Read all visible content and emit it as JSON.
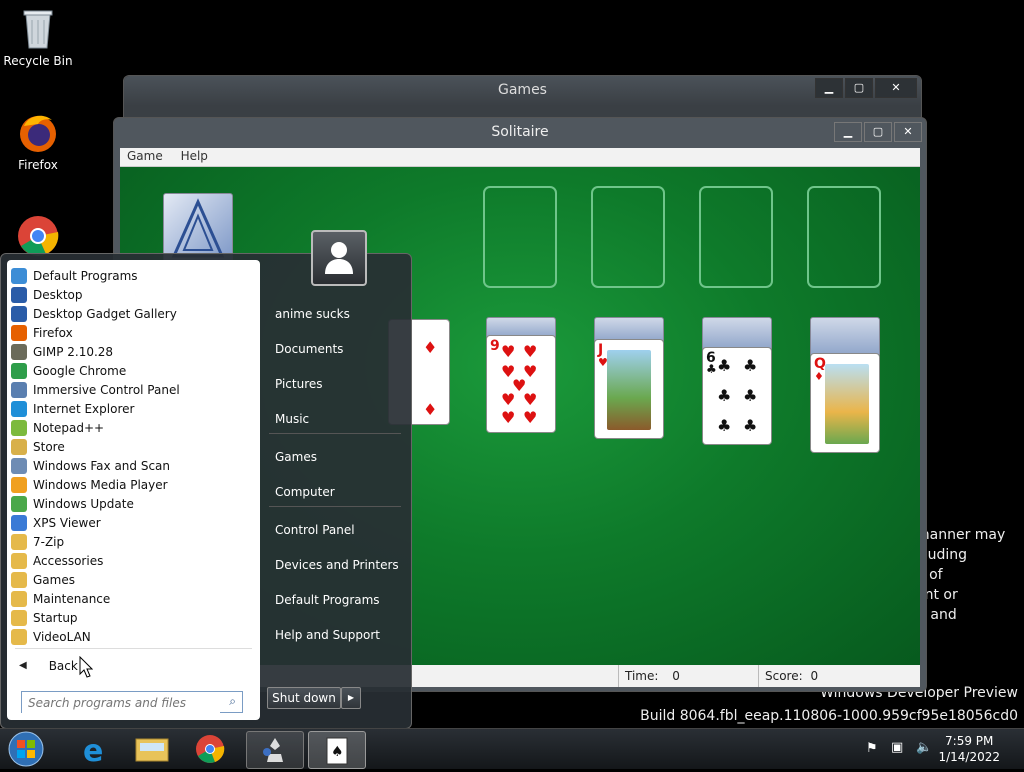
{
  "desktop": {
    "icons": [
      {
        "label": "Recycle Bin"
      },
      {
        "label": "Firefox"
      },
      {
        "label": ""
      }
    ],
    "watermark": {
      "line1": "Windows Developer Preview",
      "line2": "Build 8064.fbl_eeap.110806-1000.959cf95e18056cd0"
    },
    "bg_text": [
      "manner may",
      "cluding",
      "e of",
      "ent or",
      "), and"
    ]
  },
  "games_window": {
    "title": "Games",
    "buttons": {
      "minimize": "▁",
      "maximize": "▢",
      "close": "✕"
    }
  },
  "solitaire": {
    "title": "Solitaire",
    "menu": [
      "Game",
      "Help"
    ],
    "status": {
      "time_label": "Time:",
      "time_value": "0",
      "score_label": "Score:",
      "score_value": "0"
    },
    "colors": {
      "felt": "#0e7a2a",
      "slot": "#6fc58a"
    },
    "tableau_cards": [
      {
        "rank": "9",
        "suit": "♥",
        "color": "red"
      },
      {
        "rank": "J",
        "suit": "♥",
        "color": "red"
      },
      {
        "rank": "6",
        "suit": "♣",
        "color": "black"
      },
      {
        "rank": "Q",
        "suit": "♦",
        "color": "red"
      }
    ]
  },
  "start_menu": {
    "programs": [
      {
        "label": "Default Programs",
        "color": "#3c8dd6"
      },
      {
        "label": "Desktop",
        "color": "#2a5ca8"
      },
      {
        "label": "Desktop Gadget Gallery",
        "color": "#2a5ca8"
      },
      {
        "label": "Firefox",
        "color": "#e66000"
      },
      {
        "label": "GIMP 2.10.28",
        "color": "#6b6b5a"
      },
      {
        "label": "Google Chrome",
        "color": "#2e9d4a"
      },
      {
        "label": "Immersive Control Panel",
        "color": "#5a7fb0"
      },
      {
        "label": "Internet Explorer",
        "color": "#1f8fd8"
      },
      {
        "label": "Notepad++",
        "color": "#7cba3d"
      },
      {
        "label": "Store",
        "color": "#d8b04a"
      },
      {
        "label": "Windows Fax and Scan",
        "color": "#6e8cb4"
      },
      {
        "label": "Windows Media Player",
        "color": "#f0a020"
      },
      {
        "label": "Windows Update",
        "color": "#4aa84a"
      },
      {
        "label": "XPS Viewer",
        "color": "#3a7ad6"
      },
      {
        "label": "7-Zip",
        "color": "#e5b94a"
      },
      {
        "label": "Accessories",
        "color": "#e5b94a"
      },
      {
        "label": "Games",
        "color": "#e5b94a"
      },
      {
        "label": "Maintenance",
        "color": "#e5b94a"
      },
      {
        "label": "Startup",
        "color": "#e5b94a"
      },
      {
        "label": "VideoLAN",
        "color": "#e5b94a"
      }
    ],
    "back_label": "Back",
    "search_placeholder": "Search programs and files",
    "right_items": [
      "anime sucks",
      "Documents",
      "Pictures",
      "Music",
      "Games",
      "Computer",
      "Control Panel",
      "Devices and Printers",
      "Default Programs",
      "Help and Support"
    ],
    "shutdown_label": "Shut down"
  },
  "taskbar": {
    "clock_time": "7:59 PM",
    "clock_date": "1/14/2022"
  }
}
